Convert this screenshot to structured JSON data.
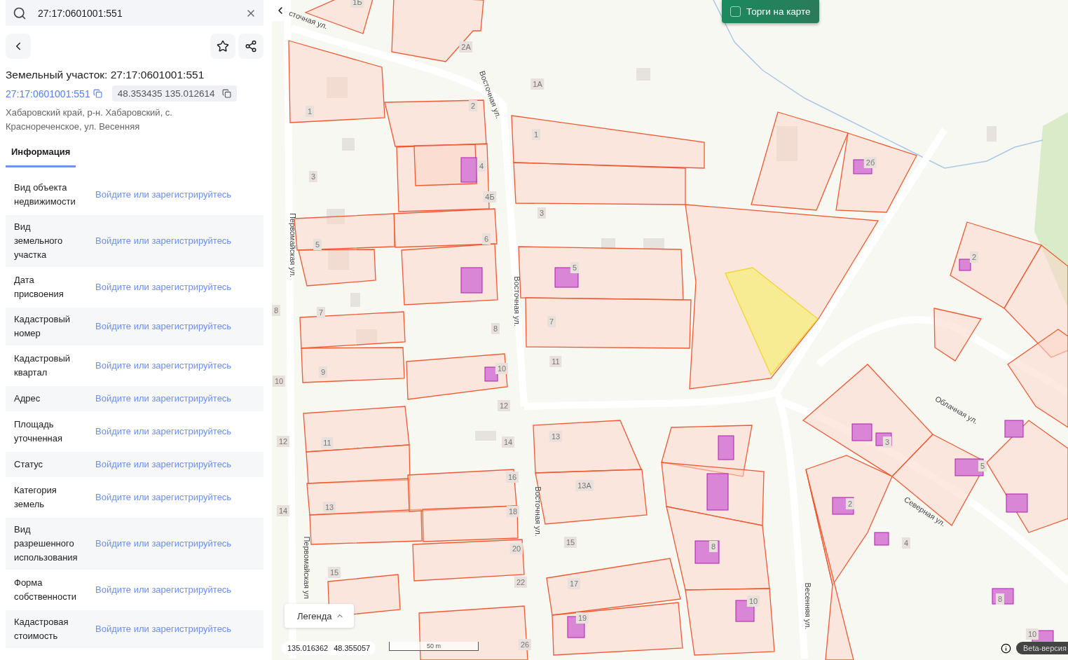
{
  "search": {
    "value": "27:17:0601001:551"
  },
  "object": {
    "title": "Земельный участок: 27:17:0601001:551",
    "cadastral_link": "27:17:0601001:551",
    "coordinates": "48.353435 135.012614",
    "address": "Хабаровский край, р-н. Хабаровский, с. Краснореченское, ул. Весенняя"
  },
  "tabs": [
    {
      "label": "Информация",
      "selected": true
    }
  ],
  "properties": [
    {
      "label": "Вид объекта недвижимости",
      "value": "Войдите или зарегистрируйтесь"
    },
    {
      "label": "Вид земельного участка",
      "value": "Войдите или зарегистрируйтесь"
    },
    {
      "label": "Дата присвоения",
      "value": "Войдите или зарегистрируйтесь"
    },
    {
      "label": "Кадастровый номер",
      "value": "Войдите или зарегистрируйтесь"
    },
    {
      "label": "Кадастровый квартал",
      "value": "Войдите или зарегистрируйтесь"
    },
    {
      "label": "Адрес",
      "value": "Войдите или зарегистрируйтесь"
    },
    {
      "label": "Площадь уточненная",
      "value": "Войдите или зарегистрируйтесь"
    },
    {
      "label": "Статус",
      "value": "Войдите или зарегистрируйтесь"
    },
    {
      "label": "Категория земель",
      "value": "Войдите или зарегистрируйтесь"
    },
    {
      "label": "Вид разрешенного использования",
      "value": "Войдите или зарегистрируйтесь"
    },
    {
      "label": "Форма собственности",
      "value": "Войдите или зарегистрируйтесь"
    },
    {
      "label": "Кадастровая стоимость",
      "value": "Войдите или зарегистрируйтесь"
    }
  ],
  "map": {
    "auctions_toggle": {
      "label": "Торги на карте",
      "checked": false
    },
    "house_numbers": [
      "1Б",
      "2А",
      "1А",
      "1",
      "2",
      "1",
      "3",
      "4",
      "2б",
      "4Б",
      "3",
      "5",
      "6",
      "5",
      "2",
      "8",
      "7",
      "8",
      "7",
      "10",
      "9",
      "10",
      "11",
      "12",
      "12",
      "11",
      "14",
      "13",
      "3",
      "5",
      "16",
      "13А",
      "14",
      "13",
      "18",
      "2",
      "20",
      "15",
      "8",
      "4",
      "15",
      "22",
      "17",
      "10",
      "8",
      "19",
      "26",
      "10"
    ],
    "streets": [
      "сточная ул.",
      "Восточная ул.",
      "Первомайская ул.",
      "Восточная ул.",
      "Восточная ул.",
      "Первомайская ул",
      "Весенняя ул.",
      "Облачная ул.",
      "Северная ул."
    ],
    "legend": {
      "label": "Легенда"
    },
    "cursor_coordinates": [
      "135.016362",
      "48.355057"
    ],
    "scale": "50 m",
    "beta_badge": "Beta-версия"
  }
}
